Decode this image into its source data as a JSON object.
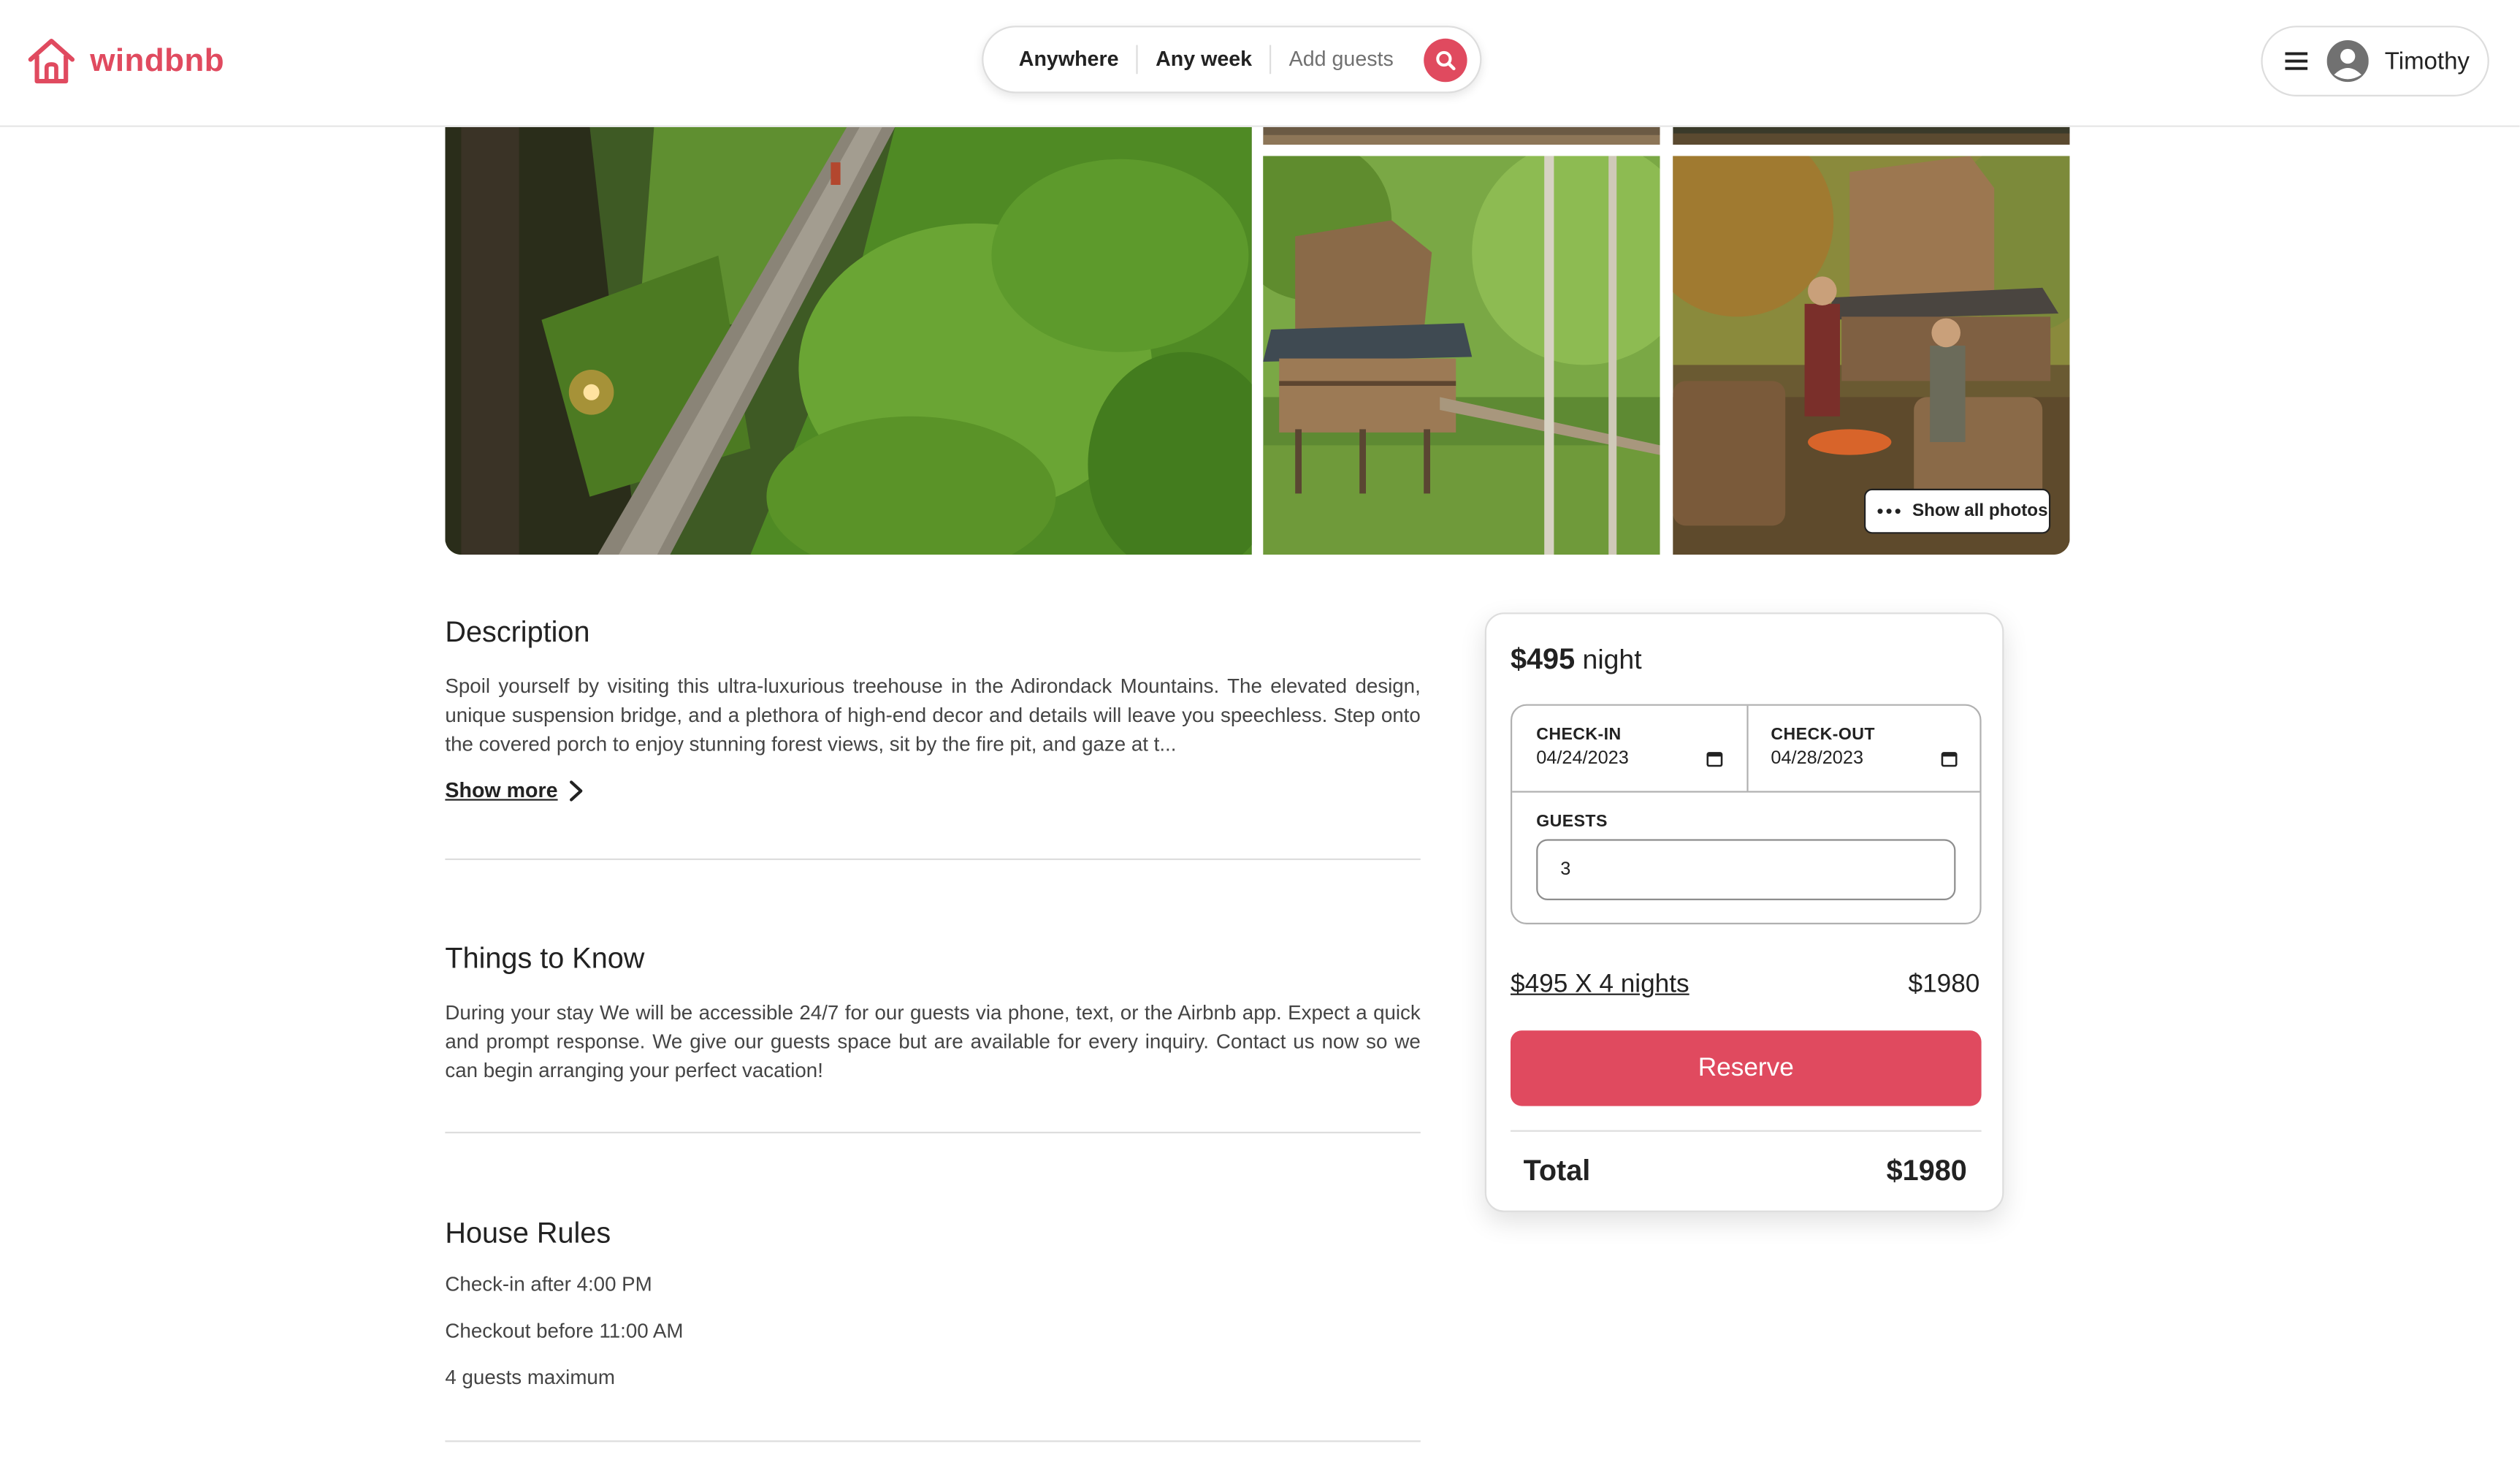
{
  "header": {
    "logo_text": "windbnb",
    "search": {
      "location": "Anywhere",
      "week": "Any week",
      "guests_placeholder": "Add guests"
    },
    "user": {
      "name": "Timothy"
    }
  },
  "gallery": {
    "show_all_label": "Show all photos"
  },
  "description": {
    "title": "Description",
    "text": "Spoil yourself by visiting this ultra-luxurious treehouse in the Adirondack Mountains. The elevated design, unique suspension bridge, and a plethora of high-end decor and details will leave you speechless. Step onto the covered porch to enjoy stunning forest views, sit by the fire pit, and gaze at t...",
    "show_more_label": "Show more"
  },
  "things_to_know": {
    "title": "Things to Know",
    "text": "During your stay We will be accessible 24/7 for our guests via phone, text, or the Airbnb app. Expect a quick and prompt response. We give our guests space but are available for every inquiry. Contact us now so we can begin arranging your perfect vacation!"
  },
  "house_rules": {
    "title": "House Rules",
    "rules": [
      "Check-in after 4:00 PM",
      "Checkout before 11:00 AM",
      "4 guests maximum"
    ]
  },
  "booking": {
    "price": "$495",
    "per_label": "night",
    "checkin_label": "CHECK-IN",
    "checkin_value": "04/24/2023",
    "checkout_label": "CHECK-OUT",
    "checkout_value": "04/28/2023",
    "guests_label": "GUESTS",
    "guests_value": "3",
    "calc_label": "$495 X 4 nights",
    "calc_amount": "$1980",
    "reserve_label": "Reserve",
    "total_label": "Total",
    "total_amount": "$1980"
  },
  "colors": {
    "brand": "#e04a5f",
    "text": "#222222",
    "muted_text": "#717171",
    "border": "#dddddd"
  },
  "icons": {
    "logo": "house-icon",
    "search": "search-icon",
    "menu": "hamburger-menu-icon",
    "avatar": "user-avatar-icon",
    "dots": "dots-icon",
    "show_more": "chevron-right-icon",
    "calendar": "calendar-icon"
  }
}
